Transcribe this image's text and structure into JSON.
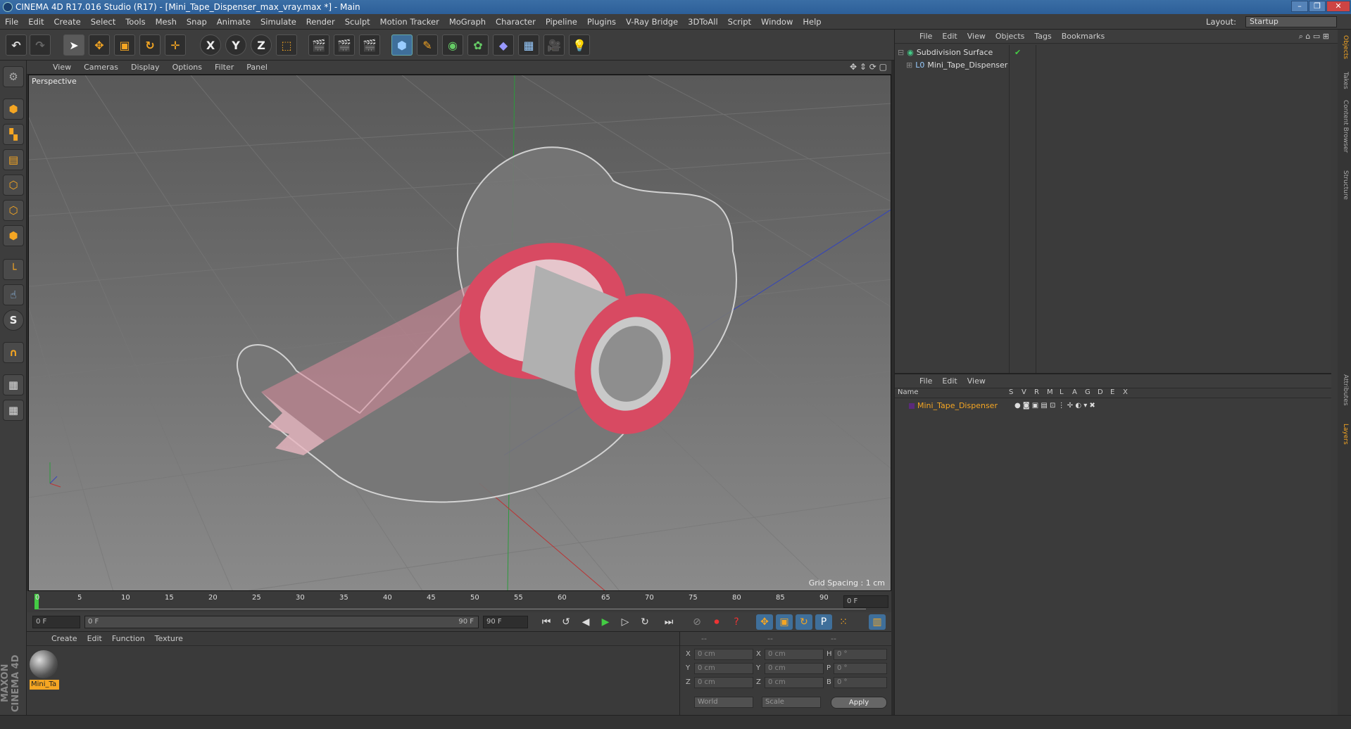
{
  "window": {
    "title": "CINEMA 4D R17.016 Studio (R17) - [Mini_Tape_Dispenser_max_vray.max *] - Main",
    "controls": [
      "–",
      "❐",
      "✕"
    ]
  },
  "menubar": {
    "items": [
      "File",
      "Edit",
      "Create",
      "Select",
      "Tools",
      "Mesh",
      "Snap",
      "Animate",
      "Simulate",
      "Render",
      "Sculpt",
      "Motion Tracker",
      "MoGraph",
      "Character",
      "Pipeline",
      "Plugins",
      "V-Ray Bridge",
      "3DToAll",
      "Script",
      "Window",
      "Help"
    ],
    "layout_label": "Layout:",
    "layout_value": "Startup"
  },
  "toolbar": {
    "axis_x": "X",
    "axis_y": "Y",
    "axis_z": "Z"
  },
  "viewport": {
    "menu": [
      "View",
      "Cameras",
      "Display",
      "Options",
      "Filter",
      "Panel"
    ],
    "label": "Perspective",
    "grid_spacing": "Grid Spacing : 1 cm"
  },
  "timeline": {
    "ticks": [
      "0",
      "5",
      "10",
      "15",
      "20",
      "25",
      "30",
      "35",
      "40",
      "45",
      "50",
      "55",
      "60",
      "65",
      "70",
      "75",
      "80",
      "85",
      "90"
    ],
    "current_frame": "0 F",
    "start_field": "0 F",
    "range_start": "0 F",
    "range_end": "90 F",
    "end_field": "90 F"
  },
  "material_panel": {
    "menu": [
      "Create",
      "Edit",
      "Function",
      "Texture"
    ],
    "material_name": "Mini_Ta"
  },
  "coord_panel": {
    "header": [
      "--",
      "--",
      "--"
    ],
    "rows": [
      {
        "a": "X",
        "av": "0 cm",
        "b": "X",
        "bv": "0 cm",
        "c": "H",
        "cv": "0 °"
      },
      {
        "a": "Y",
        "av": "0 cm",
        "b": "Y",
        "bv": "0 cm",
        "c": "P",
        "cv": "0 °"
      },
      {
        "a": "Z",
        "av": "0 cm",
        "b": "Z",
        "bv": "0 cm",
        "c": "B",
        "cv": "0 °"
      }
    ],
    "world": "World",
    "scale": "Scale",
    "apply": "Apply"
  },
  "object_manager": {
    "menu": [
      "File",
      "Edit",
      "View",
      "Objects",
      "Tags",
      "Bookmarks"
    ],
    "objects": [
      "Subdivision Surface",
      "Mini_Tape_Dispenser"
    ]
  },
  "layer_manager": {
    "menu": [
      "File",
      "Edit",
      "View"
    ],
    "columns": [
      "Name",
      "S",
      "V",
      "R",
      "M",
      "L",
      "A",
      "G",
      "D",
      "E",
      "X"
    ],
    "layer_name": "Mini_Tape_Dispenser"
  },
  "side_tabs": [
    "Objects",
    "Takes",
    "Content Browser",
    "Structure",
    "Attributes",
    "Layers"
  ],
  "branding": "MAXON CINEMA 4D"
}
